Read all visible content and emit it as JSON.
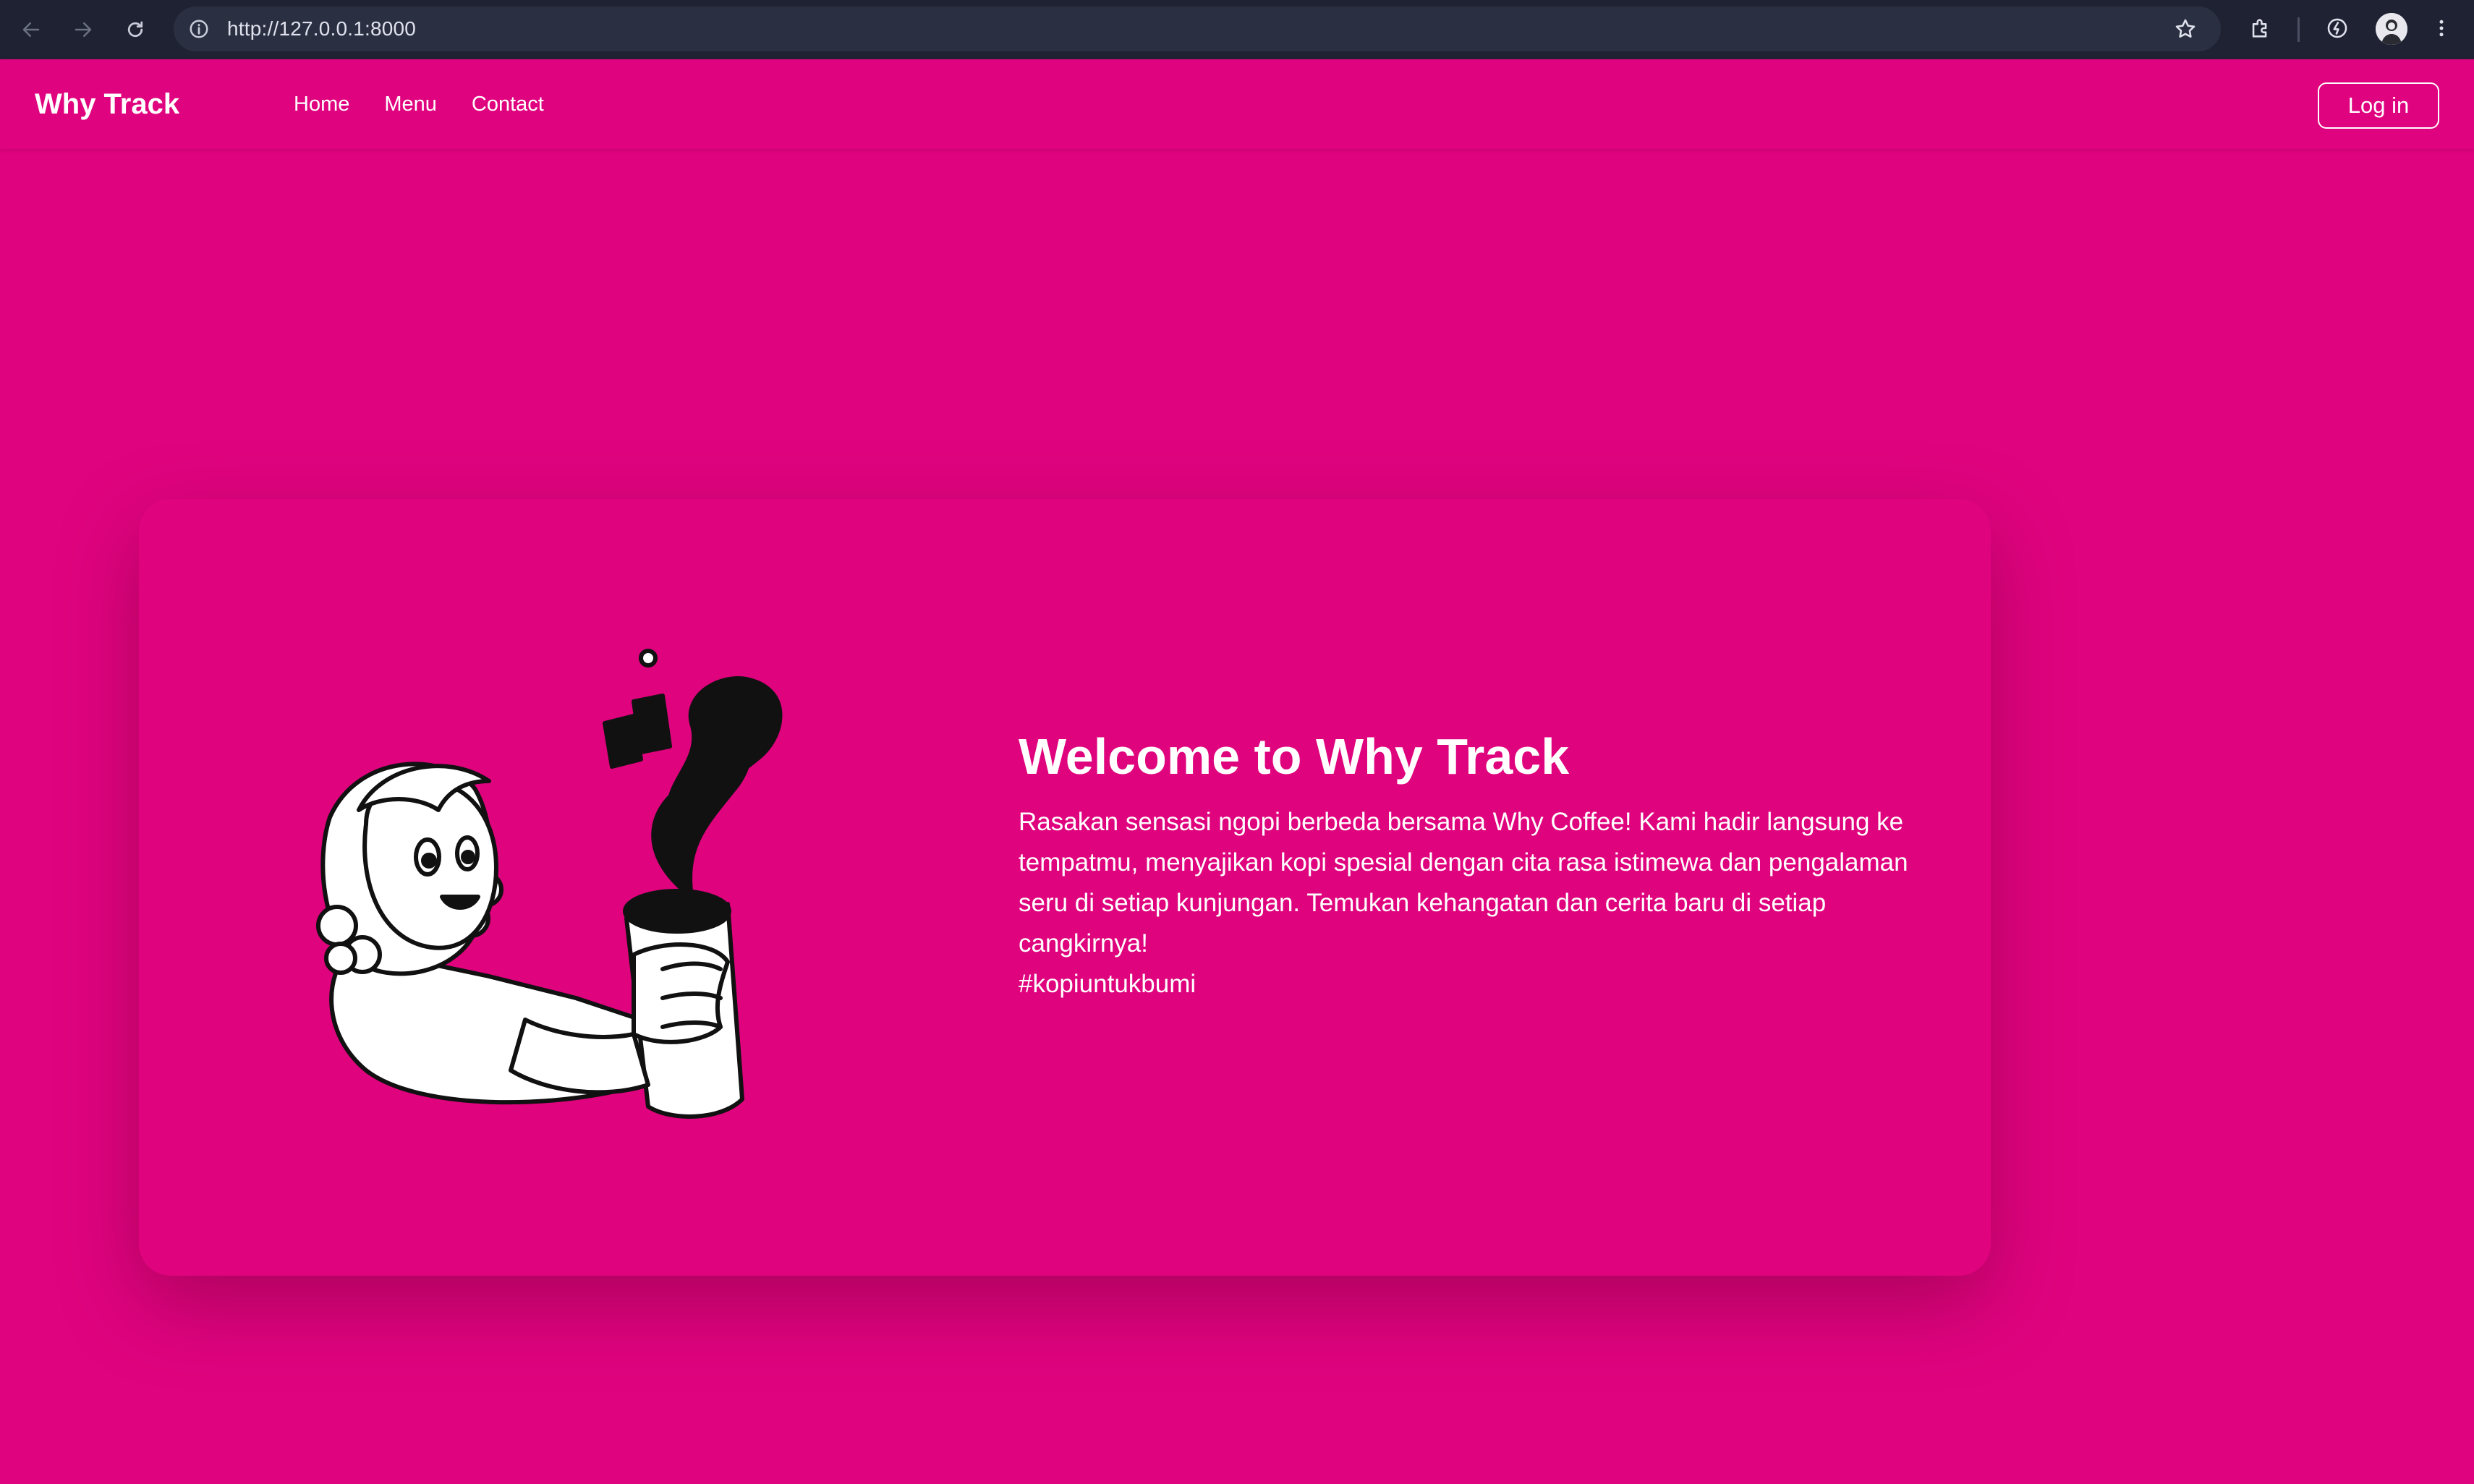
{
  "browser": {
    "url": "http://127.0.0.1:8000"
  },
  "header": {
    "brand": "Why Track",
    "nav": [
      "Home",
      "Menu",
      "Contact"
    ],
    "login_label": "Log in"
  },
  "hero": {
    "title": "Welcome to Why Track",
    "description": "Rasakan sensasi ngopi berbeda bersama Why Coffee! Kami hadir langsung ke tempatmu, menyajikan kopi spesial dengan cita rasa istimewa dan pengalaman seru di setiap kunjungan. Temukan kehangatan dan cerita baru di setiap cangkirnya!",
    "hashtag": "#kopiuntukbumi"
  },
  "colors": {
    "background": "#e0037f",
    "chrome": "#1e2233",
    "text": "#ffffff"
  }
}
